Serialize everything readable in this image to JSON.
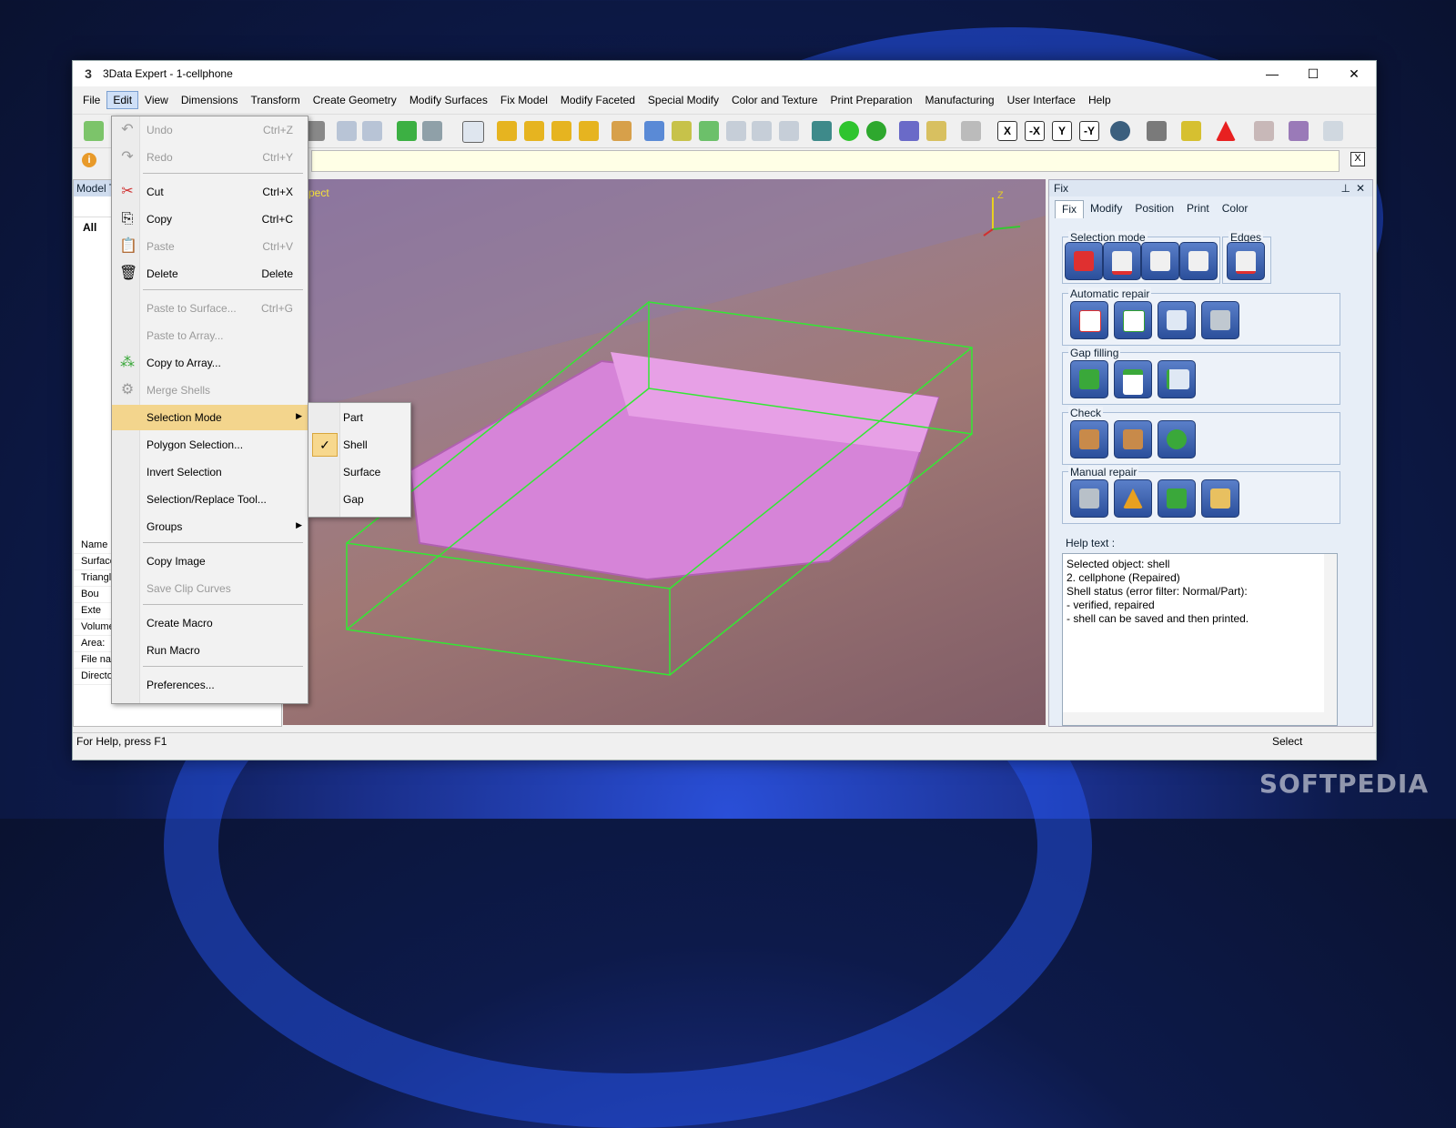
{
  "desktop": {
    "watermark": "SOFTPEDIA"
  },
  "window": {
    "title": "3Data Expert - 1-cellphone",
    "controls": {
      "minimize": "—",
      "maximize": "☐",
      "close": "✕"
    }
  },
  "menubar": {
    "items": [
      "File",
      "Edit",
      "View",
      "Dimensions",
      "Transform",
      "Create Geometry",
      "Modify Surfaces",
      "Fix Model",
      "Modify Faceted",
      "Special Modify",
      "Color and Texture",
      "Print Preparation",
      "Manufacturing",
      "User Interface",
      "Help"
    ],
    "active": "Edit"
  },
  "toolbar": {
    "axis_buttons": [
      "X",
      "-X",
      "Y",
      "-Y"
    ]
  },
  "infobar": {
    "icon": "i",
    "close": "X"
  },
  "left_panel": {
    "header": "Model T",
    "tree": {
      "root": "All"
    },
    "properties": [
      "Name",
      "Surface",
      "Triangl",
      "Bou",
      "Exte",
      "Volume",
      "Area:",
      "File nar",
      "Directo"
    ]
  },
  "viewport": {
    "label": "spect",
    "axis_z": "Z"
  },
  "edit_menu": {
    "items": [
      {
        "label": "Undo",
        "shortcut": "Ctrl+Z",
        "disabled": true,
        "icon": "↶"
      },
      {
        "label": "Redo",
        "shortcut": "Ctrl+Y",
        "disabled": true,
        "icon": "↷"
      },
      {
        "label": "Cut",
        "shortcut": "Ctrl+X",
        "disabled": false,
        "icon": "✂"
      },
      {
        "label": "Copy",
        "shortcut": "Ctrl+C",
        "disabled": false,
        "icon": "⎘"
      },
      {
        "label": "Paste",
        "shortcut": "Ctrl+V",
        "disabled": true,
        "icon": "📋"
      },
      {
        "label": "Delete",
        "shortcut": "Delete",
        "disabled": false,
        "icon": "🗑"
      },
      {
        "label": "Paste to Surface...",
        "shortcut": "Ctrl+G",
        "disabled": true,
        "icon": ""
      },
      {
        "label": "Paste to Array...",
        "shortcut": "",
        "disabled": true,
        "icon": ""
      },
      {
        "label": "Copy to Array...",
        "shortcut": "",
        "disabled": false,
        "icon": "⁂"
      },
      {
        "label": "Merge Shells",
        "shortcut": "",
        "disabled": true,
        "icon": "⚙"
      },
      {
        "label": "Selection Mode",
        "shortcut": "",
        "disabled": false,
        "icon": "",
        "submenu": true,
        "highlighted": true
      },
      {
        "label": "Polygon Selection...",
        "shortcut": "",
        "disabled": false,
        "icon": ""
      },
      {
        "label": "Invert Selection",
        "shortcut": "",
        "disabled": false,
        "icon": ""
      },
      {
        "label": "Selection/Replace Tool...",
        "shortcut": "",
        "disabled": false,
        "icon": ""
      },
      {
        "label": "Groups",
        "shortcut": "",
        "disabled": false,
        "icon": "",
        "submenu": true
      },
      {
        "label": "Copy Image",
        "shortcut": "",
        "disabled": false,
        "icon": ""
      },
      {
        "label": "Save Clip Curves",
        "shortcut": "",
        "disabled": true,
        "icon": ""
      },
      {
        "label": "Create Macro",
        "shortcut": "",
        "disabled": false,
        "icon": ""
      },
      {
        "label": "Run Macro",
        "shortcut": "",
        "disabled": false,
        "icon": ""
      },
      {
        "label": "Preferences...",
        "shortcut": "",
        "disabled": false,
        "icon": ""
      }
    ]
  },
  "selection_submenu": {
    "items": [
      "Part",
      "Shell",
      "Surface",
      "Gap"
    ],
    "checked": "Shell",
    "check_glyph": "✓"
  },
  "fix_panel": {
    "title": "Fix",
    "tabs": [
      "Fix",
      "Modify",
      "Position",
      "Print",
      "Color"
    ],
    "active_tab": "Fix",
    "groups": {
      "selection_mode": "Selection mode",
      "edges": "Edges",
      "automatic_repair": "Automatic repair",
      "gap_filling": "Gap filling",
      "check": "Check",
      "manual_repair": "Manual repair"
    },
    "help_label": "Help text :",
    "help_text": [
      "Selected object: shell",
      "2. cellphone (Repaired)",
      "",
      "Shell status (error filter: Normal/Part):",
      "- verified, repaired",
      "- shell can be saved and then printed."
    ]
  },
  "statusbar": {
    "left": "For Help, press F1",
    "right": "Select"
  }
}
